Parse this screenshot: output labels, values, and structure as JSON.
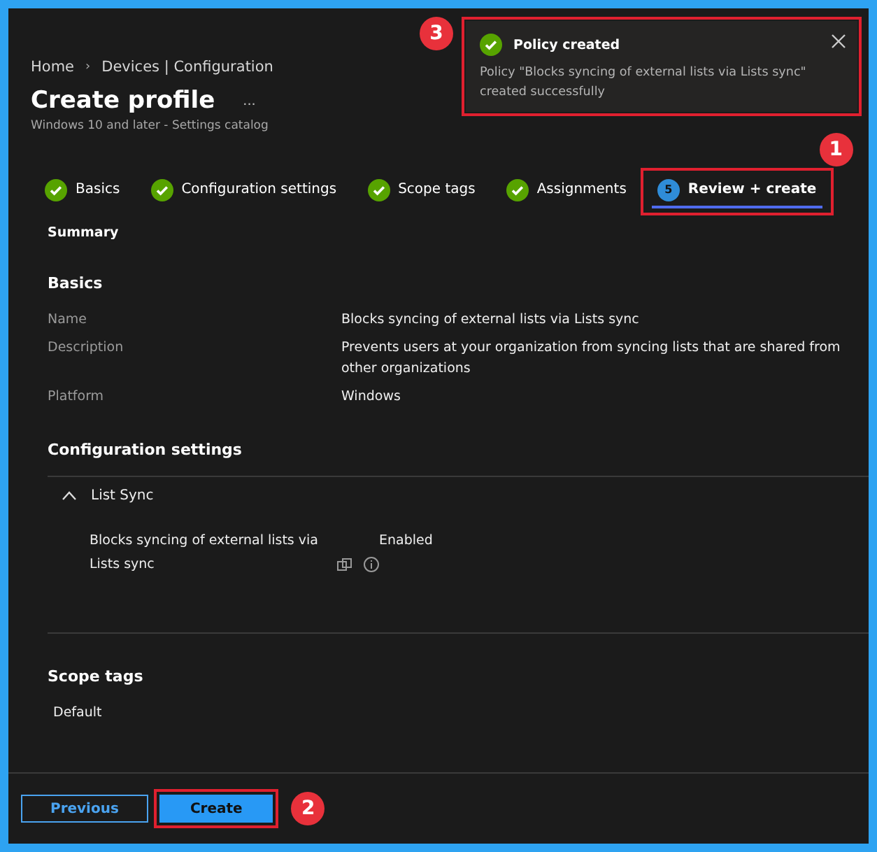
{
  "breadcrumb": [
    {
      "label": "Home"
    },
    {
      "separator": "›",
      "label": "Devices | Configuration"
    }
  ],
  "page": {
    "title": "Create profile",
    "more": "...",
    "subtitle": "Windows 10 and later - Settings catalog"
  },
  "steps": [
    {
      "label": "Basics",
      "kind": "done",
      "selected": false
    },
    {
      "label": "Configuration settings",
      "kind": "done",
      "selected": false
    },
    {
      "label": "Scope tags",
      "kind": "done",
      "selected": false
    },
    {
      "label": "Assignments",
      "kind": "done",
      "selected": false
    },
    {
      "label": "Review + create",
      "kind": "current",
      "number": "5",
      "selected": true,
      "callout": "1"
    }
  ],
  "summary_label": "Summary",
  "basics": {
    "heading": "Basics",
    "rows": [
      {
        "label": "Name",
        "value": "Blocks syncing of external lists via Lists sync"
      },
      {
        "label": "Description",
        "value": "Prevents users at your organization from syncing lists that are shared from other organizations"
      },
      {
        "label": "Platform",
        "value": "Windows"
      }
    ]
  },
  "configuration": {
    "heading": "Configuration settings",
    "groups": [
      {
        "name": "List Sync",
        "expanded": true,
        "settings": [
          {
            "name": "Blocks syncing of external lists via Lists sync",
            "value": "Enabled"
          }
        ]
      }
    ]
  },
  "scope_tags": {
    "heading": "Scope tags",
    "values": [
      "Default"
    ]
  },
  "footer": {
    "buttons": [
      {
        "label": "Previous",
        "kind": "secondary"
      },
      {
        "label": "Create",
        "kind": "primary",
        "callout": "2"
      }
    ]
  },
  "toast": {
    "title": "Policy created",
    "message": "Policy \"Blocks syncing of external lists via Lists sync\" created successfully",
    "callout": "3"
  }
}
